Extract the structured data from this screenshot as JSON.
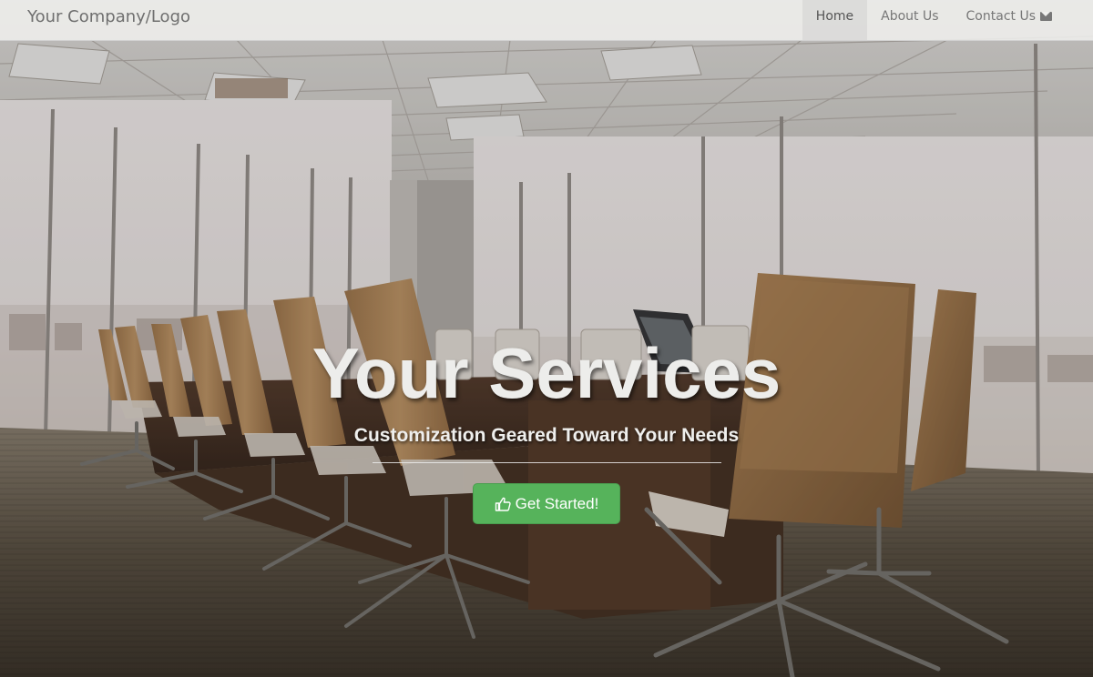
{
  "navbar": {
    "brand": "Your Company/Logo",
    "items": [
      {
        "label": "Home",
        "active": true
      },
      {
        "label": "About Us",
        "active": false
      },
      {
        "label": "Contact Us",
        "active": false,
        "icon": "envelope-icon"
      }
    ]
  },
  "hero": {
    "title": "Your Services",
    "subtitle": "Customization Geared Toward Your Needs",
    "button_label": "Get Started!",
    "button_icon": "thumbs-up-icon",
    "background_image": "conference-room-photo"
  },
  "colors": {
    "button": "#56b35b",
    "navbar_bg": "#f0f0ee",
    "nav_active_bg": "#d7d7d5",
    "text_light": "#ededeb"
  }
}
